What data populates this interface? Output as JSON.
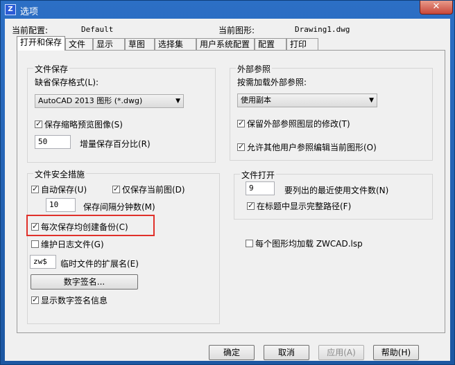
{
  "window": {
    "title": "选项",
    "close_symbol": "✕",
    "icon_text": "Z"
  },
  "header": {
    "current_profile_label": "当前配置:",
    "current_profile_value": "Default",
    "current_drawing_label": "当前图形:",
    "current_drawing_value": "Drawing1.dwg"
  },
  "tabs": [
    "打开和保存",
    "文件",
    "显示",
    "草图",
    "选择集",
    "用户系统配置",
    "配置",
    "打印"
  ],
  "active_tab": "打开和保存",
  "file_save": {
    "title": "文件保存",
    "format_label": "缺省保存格式(L):",
    "format_value": "AutoCAD 2013 图形 (*.dwg)",
    "thumbnail_label": "保存缩略预览图像(S)",
    "thumbnail_checked": true,
    "incremental_value": "50",
    "incremental_label": "增量保存百分比(R)"
  },
  "xref": {
    "title": "外部参照",
    "load_label": "按需加载外部参照:",
    "load_value": "使用副本",
    "retain_label": "保留外部参照图层的修改(T)",
    "retain_checked": true,
    "allow_edit_label": "允许其他用户参照编辑当前图形(O)",
    "allow_edit_checked": true
  },
  "file_safety": {
    "title": "文件安全措施",
    "autosave_label": "自动保存(U)",
    "autosave_checked": true,
    "current_only_label": "仅保存当前图(D)",
    "current_only_checked": true,
    "interval_value": "10",
    "interval_label": "保存间隔分钟数(M)",
    "backup_label": "每次保存均创建备份(C)",
    "backup_checked": true,
    "log_label": "维护日志文件(G)",
    "log_checked": false,
    "temp_ext_value": "zw$",
    "temp_ext_label": "临时文件的扩展名(E)",
    "digital_sig_button": "数字签名...",
    "show_sig_label": "显示数字签名信息",
    "show_sig_checked": true
  },
  "file_open": {
    "title": "文件打开",
    "recent_value": "9",
    "recent_label": "要列出的最近使用文件数(N)",
    "fullpath_label": "在标题中显示完整路径(F)",
    "fullpath_checked": true
  },
  "load_lsp": {
    "label": "每个图形均加载 ZWCAD.lsp",
    "checked": false
  },
  "footer": {
    "ok": "确定",
    "cancel": "取消",
    "apply": "应用(A)",
    "help": "帮助(H)"
  },
  "accent_highlight_color": "#e0302a"
}
